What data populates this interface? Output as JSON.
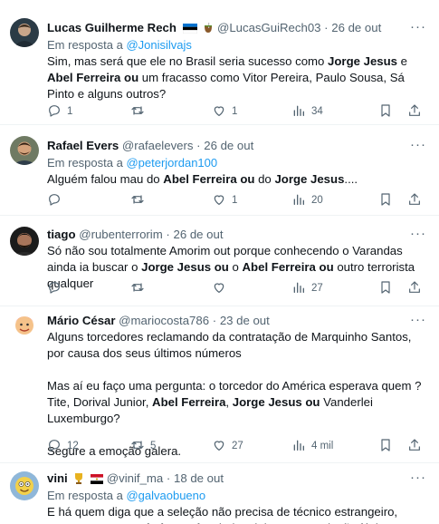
{
  "tweets": [
    {
      "name": "Lucas Guilherme Rech",
      "handle": "@LucasGuiRech03",
      "date": "26 de out",
      "reply_prefix": "Em resposta a",
      "reply_to": "@Jonisilvajs",
      "text_parts": [
        {
          "t": "Sim, mas será que ele no Brasil seria sucesso como ",
          "b": false
        },
        {
          "t": "Jorge Jesus",
          "b": true
        },
        {
          "t": " e ",
          "b": false
        },
        {
          "t": "Abel Ferreira ou",
          "b": true
        },
        {
          "t": " um fracasso como Vitor Pereira, Paulo Sousa, Sá Pinto e alguns outros?",
          "b": false
        }
      ],
      "replies": "1",
      "retweets": "",
      "likes": "1",
      "views": "34"
    },
    {
      "name": "Rafael Evers",
      "handle": "@rafaelevers",
      "date": "26 de out",
      "reply_prefix": "Em resposta a",
      "reply_to": "@peterjordan100",
      "text_parts": [
        {
          "t": "Alguém falou mau do ",
          "b": false
        },
        {
          "t": "Abel Ferreira ou",
          "b": true
        },
        {
          "t": " do ",
          "b": false
        },
        {
          "t": "Jorge Jesus",
          "b": true
        },
        {
          "t": "....",
          "b": false
        }
      ],
      "replies": "",
      "retweets": "",
      "likes": "1",
      "views": "20"
    },
    {
      "name": "tiago",
      "handle": "@rubenterrorim",
      "date": "26 de out",
      "reply_prefix": "",
      "reply_to": "",
      "text_parts": [
        {
          "t": "Só não sou totalmente Amorim out porque conhecendo o Varandas ainda ia buscar o ",
          "b": false
        },
        {
          "t": "Jorge Jesus ou",
          "b": true
        },
        {
          "t": " o ",
          "b": false
        },
        {
          "t": "Abel Ferreira ou",
          "b": true
        },
        {
          "t": " outro terrorista qualquer",
          "b": false
        }
      ],
      "replies": "",
      "retweets": "",
      "likes": "",
      "views": "27"
    },
    {
      "name": "Mário César",
      "handle": "@mariocosta786",
      "date": "23 de out",
      "reply_prefix": "",
      "reply_to": "",
      "text_parts": [
        {
          "t": "Alguns torcedores reclamando da contratação de Marquinho Santos, por causa dos seus últimos números\n\nMas aí eu faço uma pergunta: o torcedor do América esperava quem ? Tite, Dorival Junior, ",
          "b": false
        },
        {
          "t": "Abel Ferreira",
          "b": true
        },
        {
          "t": ", ",
          "b": false
        },
        {
          "t": "Jorge Jesus ou",
          "b": true
        },
        {
          "t": " Vanderlei Luxemburgo?\n\nSegure a emoção galera.",
          "b": false
        }
      ],
      "replies": "12",
      "retweets": "5",
      "likes": "27",
      "views": "4 mil"
    },
    {
      "name": "vini",
      "handle": "@vinif_ma",
      "date": "18 de out",
      "reply_prefix": "Em resposta a",
      "reply_to": "@galvaobueno",
      "text_parts": [
        {
          "t": "E há quem diga que a seleção não precisa de técnico estrangeiro, ",
          "b": false
        },
        {
          "t": "Jorge Jesus ou",
          "b": true
        },
        {
          "t": " ",
          "b": false
        },
        {
          "t": "Abel Ferreira",
          "b": true
        },
        {
          "t": " dariam jeito nessa seleção fácio",
          "b": false
        }
      ],
      "replies": "",
      "retweets": "",
      "likes": "",
      "views": ""
    }
  ],
  "separator": "·",
  "more_label": "···",
  "icons": {
    "reply": "reply-icon",
    "retweet": "retweet-icon",
    "like": "heart-icon",
    "views": "views-icon",
    "bookmark": "bookmark-icon",
    "share": "share-icon"
  },
  "colors": {
    "link": "#1d9bf0",
    "muted": "#536471",
    "text": "#0f1419"
  }
}
